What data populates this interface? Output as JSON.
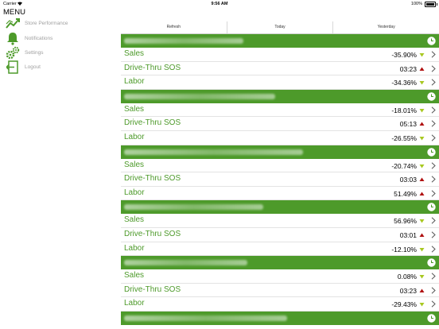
{
  "status_bar": {
    "carrier": "Carrier",
    "time": "9:56 AM",
    "battery": "100%",
    "battery_level": 1.0
  },
  "sidebar": {
    "title": "MENU",
    "items": [
      {
        "label": "Store Performance",
        "icon": "chart-trend-icon"
      },
      {
        "label": "Notifications",
        "icon": "bell-icon"
      },
      {
        "label": "Settings",
        "icon": "gears-icon"
      },
      {
        "label": "Logout",
        "icon": "logout-icon"
      }
    ]
  },
  "tabs": [
    "Refresh",
    "Today",
    "Yesterday"
  ],
  "colors": {
    "brand_green": "#4d9a2a",
    "trend_up": "#b01010",
    "trend_down": "#a8c820"
  },
  "stores": [
    {
      "name_width": 150,
      "metrics": [
        {
          "label": "Sales",
          "value": "-35.90%",
          "trend": "down"
        },
        {
          "label": "Drive-Thru SOS",
          "value": "03:23",
          "trend": "up"
        },
        {
          "label": "Labor",
          "value": "-34.36%",
          "trend": "down"
        }
      ]
    },
    {
      "name_width": 190,
      "metrics": [
        {
          "label": "Sales",
          "value": "-18.01%",
          "trend": "down"
        },
        {
          "label": "Drive-Thru SOS",
          "value": "05:13",
          "trend": "up"
        },
        {
          "label": "Labor",
          "value": "-26.55%",
          "trend": "down"
        }
      ]
    },
    {
      "name_width": 225,
      "metrics": [
        {
          "label": "Sales",
          "value": "-20.74%",
          "trend": "down"
        },
        {
          "label": "Drive-Thru SOS",
          "value": "03:03",
          "trend": "up"
        },
        {
          "label": "Labor",
          "value": "51.49%",
          "trend": "up"
        }
      ]
    },
    {
      "name_width": 175,
      "metrics": [
        {
          "label": "Sales",
          "value": "56.96%",
          "trend": "down"
        },
        {
          "label": "Drive-Thru SOS",
          "value": "03:01",
          "trend": "up"
        },
        {
          "label": "Labor",
          "value": "-12.10%",
          "trend": "down"
        }
      ]
    },
    {
      "name_width": 155,
      "metrics": [
        {
          "label": "Sales",
          "value": "0.08%",
          "trend": "down"
        },
        {
          "label": "Drive-Thru SOS",
          "value": "03:23",
          "trend": "up"
        },
        {
          "label": "Labor",
          "value": "-29.43%",
          "trend": "down"
        }
      ]
    },
    {
      "name_width": 205,
      "metrics": []
    }
  ]
}
